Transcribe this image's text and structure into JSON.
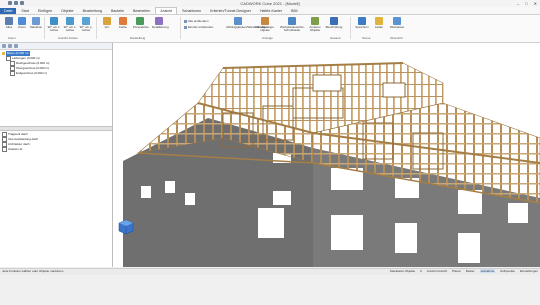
{
  "window": {
    "title": "CADWORK Cube 2021 - [Modell]",
    "min": "–",
    "max": "□",
    "close": "✕"
  },
  "tabs": [
    "Datei",
    "Start",
    "Einfügen",
    "Objekte",
    "Bearbeitung",
    "Bauteile",
    "Bearbeiten",
    "Ansicht",
    "Schablonen",
    "Kriterien/Tunnel-Designer",
    "Hafele-Kanter",
    "BIM"
  ],
  "ribbon": {
    "buttons": [
      "Alles",
      "Zoom",
      "Selektion",
      "90° um z-Achse",
      "90° um x-Achse",
      "90° um y-Achse",
      "Vol.",
      "Farbe",
      "Perspektive",
      "Detaillierung",
      "Abhängigkeiten/Wandöffnungen",
      "Detaillierungs-objekte",
      "Werkplanansichts-Schnittstelle",
      "Anderes Objekte",
      "Beschriftung",
      "Speichern",
      "Laden",
      "Werkplane"
    ],
    "small": [
      "Alle einblenden",
      "Einzeln einblenden"
    ],
    "groups": [
      "Zoom",
      "Ansicht drehen",
      "Darstellung",
      "Anzeige",
      "Gesamt",
      "Szene",
      "Übersicht"
    ]
  },
  "tree": {
    "items": [
      {
        "label": "Baum (0.000 m)",
        "level": 0,
        "selected": true
      },
      {
        "label": "Laibungen (0.000 m)",
        "level": 1
      },
      {
        "label": "Dachgeschoss (0.000 m)",
        "level": 2
      },
      {
        "label": "Obergeschoss (0.000 m)",
        "level": 2
      },
      {
        "label": "Erdgeschoss (0.000 m)",
        "level": 2
      }
    ],
    "layers": [
      "Tragwerk dach",
      "Innenverkleidung dach",
      "Architektur dach",
      "Caisson dt."
    ]
  },
  "status": {
    "message": "Jede Funktion wählen oder Objekte markieren",
    "items": [
      "Selektierte Objekte",
      "0",
      "Ansicht Ansicht",
      "Planar",
      "Raster",
      "Aufnahme",
      "Zoll/punkte",
      "Einstellungen"
    ],
    "active": "Aufnahme"
  },
  "colors": {
    "accent": "#2e6ab3",
    "timber": "#c9a774",
    "wall": "#6f6f6f"
  },
  "icons": [
    "cube-navigator-icon",
    "gear-icon"
  ]
}
